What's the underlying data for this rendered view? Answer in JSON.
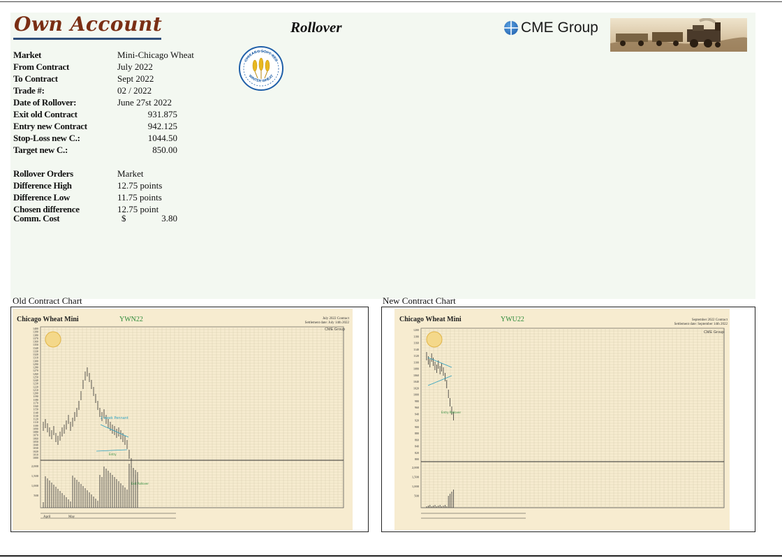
{
  "header": {
    "logo_text": "Own Account",
    "page_title": "Rollover",
    "exchange_logo_text": "CME Group",
    "seal_lines": [
      "CHICAGO SOFT RED",
      "WINTER WHEAT"
    ]
  },
  "trade": {
    "market": {
      "label": "Market",
      "value": "Mini-Chicago Wheat"
    },
    "from_contract": {
      "label": "From Contract",
      "value": "July 2022"
    },
    "to_contract": {
      "label": "To Contract",
      "value": "Sept 2022"
    },
    "trade_no": {
      "label": "Trade #:",
      "value": "02 / 2022"
    },
    "date": {
      "label": "Date of Rollover:",
      "value": "June 27st 2022"
    },
    "exit_old": {
      "label": "Exit old Contract",
      "value": "931.875"
    },
    "entry_new": {
      "label": "Entry new Contract",
      "value": "942.125"
    },
    "stop_loss": {
      "label": "Stop-Loss new C.:",
      "value": "1044.50"
    },
    "target": {
      "label": "Target new C.:",
      "value": "850.00"
    }
  },
  "rollover": {
    "orders": {
      "label": "Rollover Orders",
      "value": "Market"
    },
    "diff_high": {
      "label": "Difference High",
      "value": "12.75 points"
    },
    "diff_low": {
      "label": "Difference Low",
      "value": "11.75 points"
    },
    "chosen": {
      "label": "Chosen difference",
      "value": "12.75 point"
    },
    "comm": {
      "label": "Comm. Cost",
      "currency": "$",
      "value": "3.80"
    }
  },
  "charts": {
    "old": {
      "caption": "Old Contract Chart",
      "title": "Chicago Wheat Mini",
      "symbol": "YWN22",
      "contract_line1": "July 2022 Contract",
      "contract_line2": "Settlement date: July 14th 2022",
      "brand": "CME Group",
      "y_ticks": [
        "1400",
        "1390",
        "1380",
        "1370",
        "1360",
        "1350",
        "1340",
        "1330",
        "1320",
        "1310",
        "1300",
        "1290",
        "1280",
        "1270",
        "1260",
        "1250",
        "1240",
        "1230",
        "1220",
        "1210",
        "1200",
        "1190",
        "1180",
        "1170",
        "1160",
        "1150",
        "1140",
        "1130",
        "1120",
        "1110",
        "1100",
        "1090",
        "1080",
        "1070",
        "1060",
        "1050",
        "1040",
        "1030",
        "1020",
        "1010",
        "1000"
      ],
      "vol_ticks": [
        "2,000",
        "1,500",
        "1,000",
        "500"
      ],
      "annotations": [
        "2 week Pennant",
        "Entry",
        "Exit Rollover"
      ],
      "months": [
        "April",
        "May"
      ]
    },
    "new": {
      "caption": "New Contract Chart",
      "title": "Chicago Wheat Mini",
      "symbol": "YWU22",
      "contract_line1": "September 2022 Contract",
      "contract_line2": "Settlement date: September 14th 2022",
      "brand": "CME Group",
      "y_ticks": [
        "1200",
        "1180",
        "1160",
        "1140",
        "1120",
        "1100",
        "1080",
        "1060",
        "1040",
        "1020",
        "1000",
        "980",
        "960",
        "940",
        "920",
        "900",
        "880",
        "860",
        "840",
        "820",
        "800"
      ],
      "vol_ticks": [
        "2,000",
        "1,500",
        "1,000",
        "500"
      ],
      "annotations": [
        "Entry Rollover"
      ]
    }
  },
  "colors": {
    "logo_red": "#7a2e14",
    "rule_blue": "#2f4f7a",
    "sheet_bg": "#f3f8f1",
    "chart_paper": "#f7ecd0",
    "symbol_green": "#2e8b3a",
    "annotation_teal": "#2aa0c0"
  }
}
